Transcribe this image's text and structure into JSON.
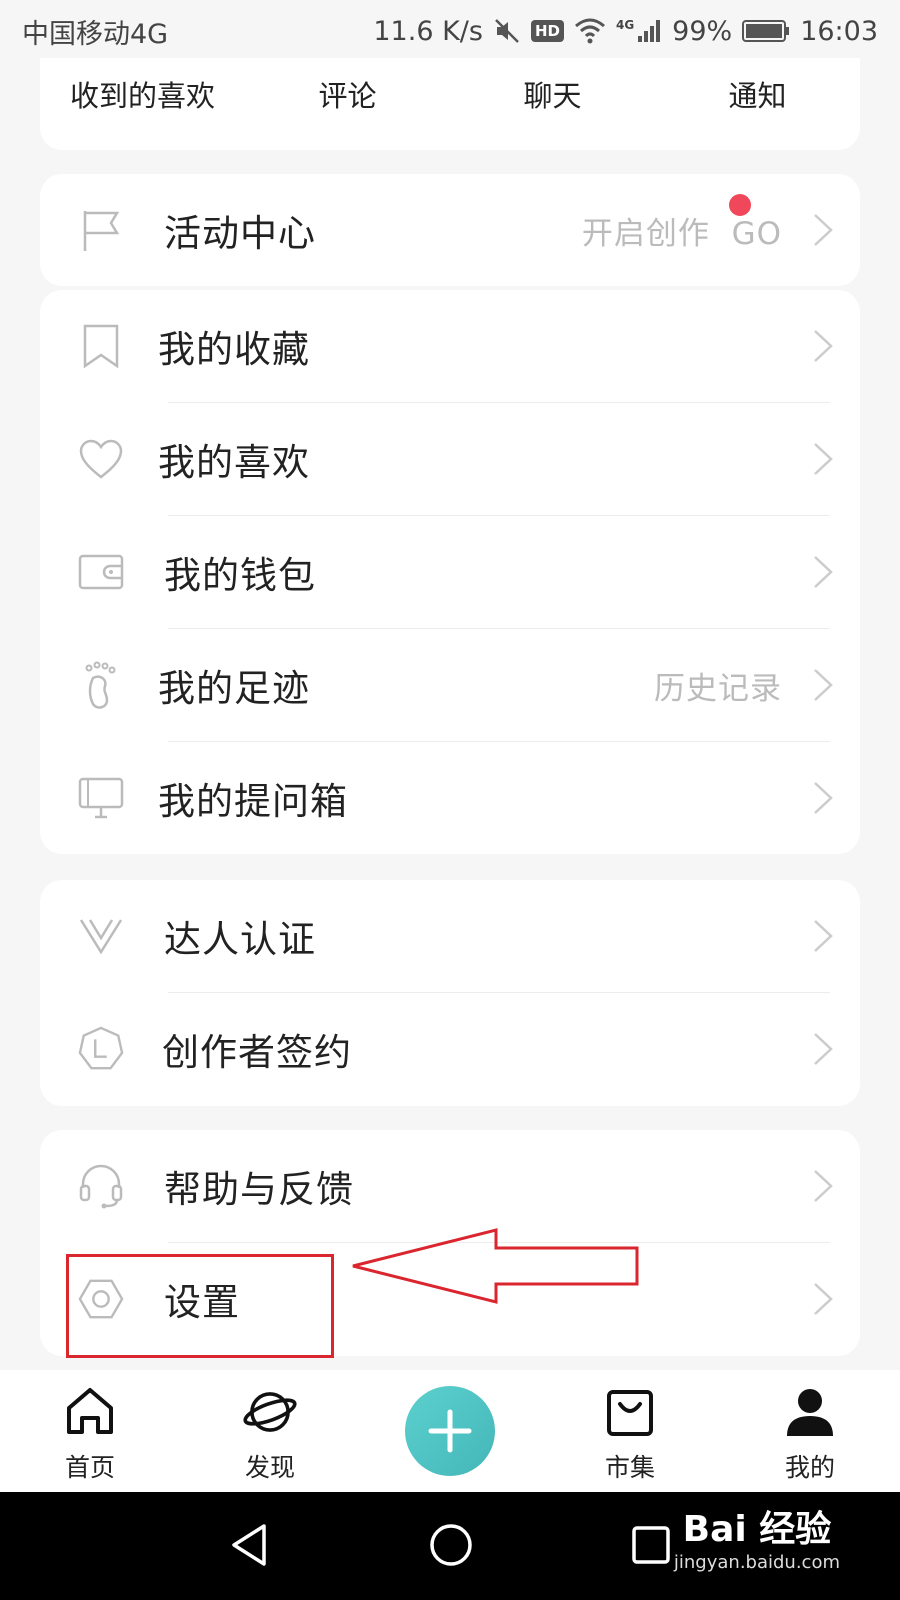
{
  "status_bar": {
    "carrier": "中国移动4G",
    "speed": "11.6 K/s",
    "hd": "HD",
    "net": "4G",
    "battery": "99%",
    "time": "16:03"
  },
  "top_tabs": [
    "收到的喜欢",
    "评论",
    "聊天",
    "通知"
  ],
  "activity": {
    "label": "活动中心",
    "sub": "开启创作",
    "go": "GO",
    "dot_color": "#f0475a"
  },
  "group1": [
    {
      "label": "我的收藏",
      "icon": "bookmark-icon"
    },
    {
      "label": "我的喜欢",
      "icon": "heart-icon"
    },
    {
      "label": "我的钱包",
      "icon": "wallet-icon"
    },
    {
      "label": "我的足迹",
      "icon": "footprint-icon",
      "sub": "历史记录"
    },
    {
      "label": "我的提问箱",
      "icon": "question-box-icon"
    }
  ],
  "group2": [
    {
      "label": "达人认证",
      "icon": "v-badge-icon"
    },
    {
      "label": "创作者签约",
      "icon": "contract-icon"
    }
  ],
  "group3": [
    {
      "label": "帮助与反馈",
      "icon": "headset-icon"
    },
    {
      "label": "设置",
      "icon": "settings-hexagon-icon"
    }
  ],
  "bottom_nav": {
    "home": "首页",
    "discover": "发现",
    "market": "市集",
    "me": "我的"
  },
  "watermark": {
    "main": "Bai 经验",
    "sub": "jingyan.baidu.com"
  },
  "colors": {
    "accent": "#4fc3c4",
    "annotation": "#d9262f"
  }
}
